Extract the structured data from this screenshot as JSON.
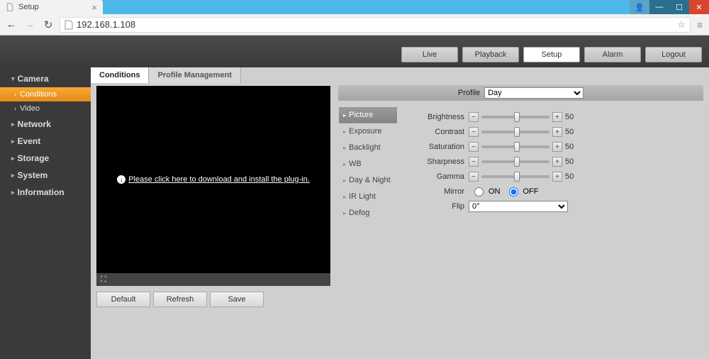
{
  "browser": {
    "tab_title": "Setup",
    "url": "192.168.1.108"
  },
  "nav": {
    "live": "Live",
    "playback": "Playback",
    "setup": "Setup",
    "alarm": "Alarm",
    "logout": "Logout"
  },
  "sidebar": {
    "camera": "Camera",
    "conditions": "Conditions",
    "video": "Video",
    "network": "Network",
    "event": "Event",
    "storage": "Storage",
    "system": "System",
    "information": "Information"
  },
  "sub_tabs": {
    "conditions": "Conditions",
    "profile_mgmt": "Profile Management"
  },
  "video": {
    "plugin_msg": "Please click here to download and install the plug-in."
  },
  "buttons": {
    "default": "Default",
    "refresh": "Refresh",
    "save": "Save"
  },
  "setting_items": {
    "picture": "Picture",
    "exposure": "Exposure",
    "backlight": "Backlight",
    "wb": "WB",
    "day_night": "Day & Night",
    "ir_light": "IR Light",
    "defog": "Defog"
  },
  "profile": {
    "label": "Profile",
    "value": "Day"
  },
  "params": {
    "brightness": {
      "label": "Brightness",
      "value": "50"
    },
    "contrast": {
      "label": "Contrast",
      "value": "50"
    },
    "saturation": {
      "label": "Saturation",
      "value": "50"
    },
    "sharpness": {
      "label": "Sharpness",
      "value": "50"
    },
    "gamma": {
      "label": "Gamma",
      "value": "50"
    },
    "mirror": {
      "label": "Mirror",
      "on": "ON",
      "off": "OFF",
      "value": "OFF"
    },
    "flip": {
      "label": "Flip",
      "value": "0°"
    }
  }
}
